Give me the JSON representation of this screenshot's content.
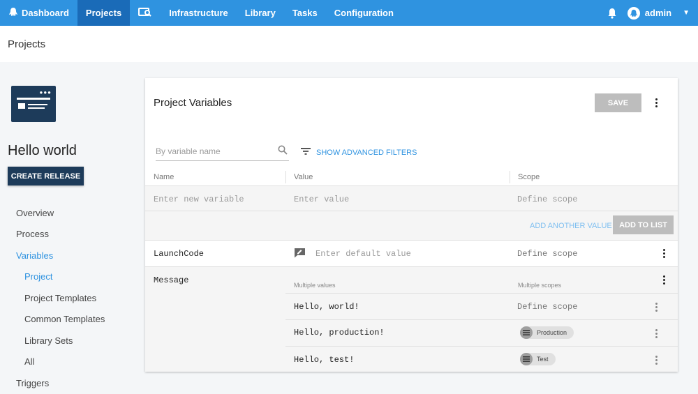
{
  "nav": {
    "dashboard": "Dashboard",
    "projects": "Projects",
    "infrastructure": "Infrastructure",
    "library": "Library",
    "tasks": "Tasks",
    "configuration": "Configuration",
    "user": "admin"
  },
  "page": {
    "breadcrumb": "Projects"
  },
  "project": {
    "name": "Hello world",
    "create_release": "CREATE RELEASE"
  },
  "sidebar": {
    "items": [
      {
        "label": "Overview"
      },
      {
        "label": "Process"
      },
      {
        "label": "Variables"
      },
      {
        "label": "Project"
      },
      {
        "label": "Project Templates"
      },
      {
        "label": "Common Templates"
      },
      {
        "label": "Library Sets"
      },
      {
        "label": "All"
      },
      {
        "label": "Triggers"
      }
    ]
  },
  "main": {
    "title": "Project Variables",
    "save": "SAVE",
    "search_placeholder": "By variable name",
    "advanced_filters": "SHOW ADVANCED FILTERS",
    "columns": {
      "name": "Name",
      "value": "Value",
      "scope": "Scope"
    },
    "new_row": {
      "name_placeholder": "Enter new variable",
      "value_placeholder": "Enter value",
      "scope_placeholder": "Define scope"
    },
    "add_another": "ADD ANOTHER VALUE",
    "add_to_list": "ADD TO LIST",
    "variables": {
      "launch": {
        "name": "LaunchCode",
        "value_placeholder": "Enter default value",
        "scope": "Define scope"
      },
      "message": {
        "name": "Message",
        "multi_values": "Multiple values",
        "multi_scopes": "Multiple scopes",
        "values": [
          {
            "value": "Hello, world!",
            "scope": "Define scope"
          },
          {
            "value": "Hello, production!",
            "scope": "Production"
          },
          {
            "value": "Hello, test!",
            "scope": "Test"
          }
        ]
      }
    }
  },
  "colors": {
    "nav": "#2f93e0",
    "nav_active": "#1a6bb8",
    "dark_button": "#1d3b5a",
    "link": "#2f93e0"
  }
}
